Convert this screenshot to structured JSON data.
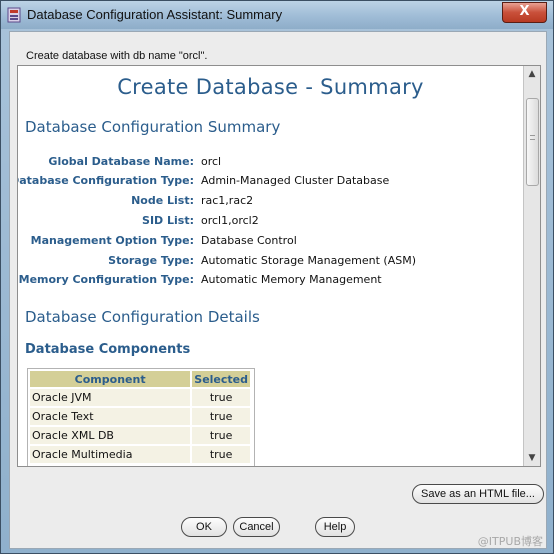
{
  "window": {
    "title": "Database Configuration Assistant: Summary",
    "close_label": "X"
  },
  "message": "Create database with db name \"orcl\".",
  "summary": {
    "page_title": "Create Database - Summary",
    "section_title": "Database Configuration Summary",
    "fields": [
      {
        "label": "Global Database Name:",
        "value": "orcl"
      },
      {
        "label": "Database Configuration Type:",
        "value": "Admin-Managed Cluster Database"
      },
      {
        "label": "Node List:",
        "value": "rac1,rac2"
      },
      {
        "label": "SID List:",
        "value": "orcl1,orcl2"
      },
      {
        "label": "Management Option Type:",
        "value": "Database Control"
      },
      {
        "label": "Storage Type:",
        "value": "Automatic Storage Management (ASM)"
      },
      {
        "label": "Memory Configuration Type:",
        "value": "Automatic Memory Management"
      }
    ],
    "details_title": "Database Configuration Details",
    "components_title": "Database Components"
  },
  "components": {
    "headers": [
      "Component",
      "Selected"
    ],
    "rows": [
      [
        "Oracle JVM",
        "true"
      ],
      [
        "Oracle Text",
        "true"
      ],
      [
        "Oracle XML DB",
        "true"
      ],
      [
        "Oracle Multimedia",
        "true"
      ]
    ]
  },
  "buttons": {
    "save_html": "Save as an HTML file...",
    "ok": "OK",
    "cancel": "Cancel",
    "help": "Help"
  },
  "watermark": "@ITPUB博客",
  "colors": {
    "heading": "#2b5d8c",
    "table_header": "#d4cf97",
    "table_cell": "#f4f2e4"
  }
}
